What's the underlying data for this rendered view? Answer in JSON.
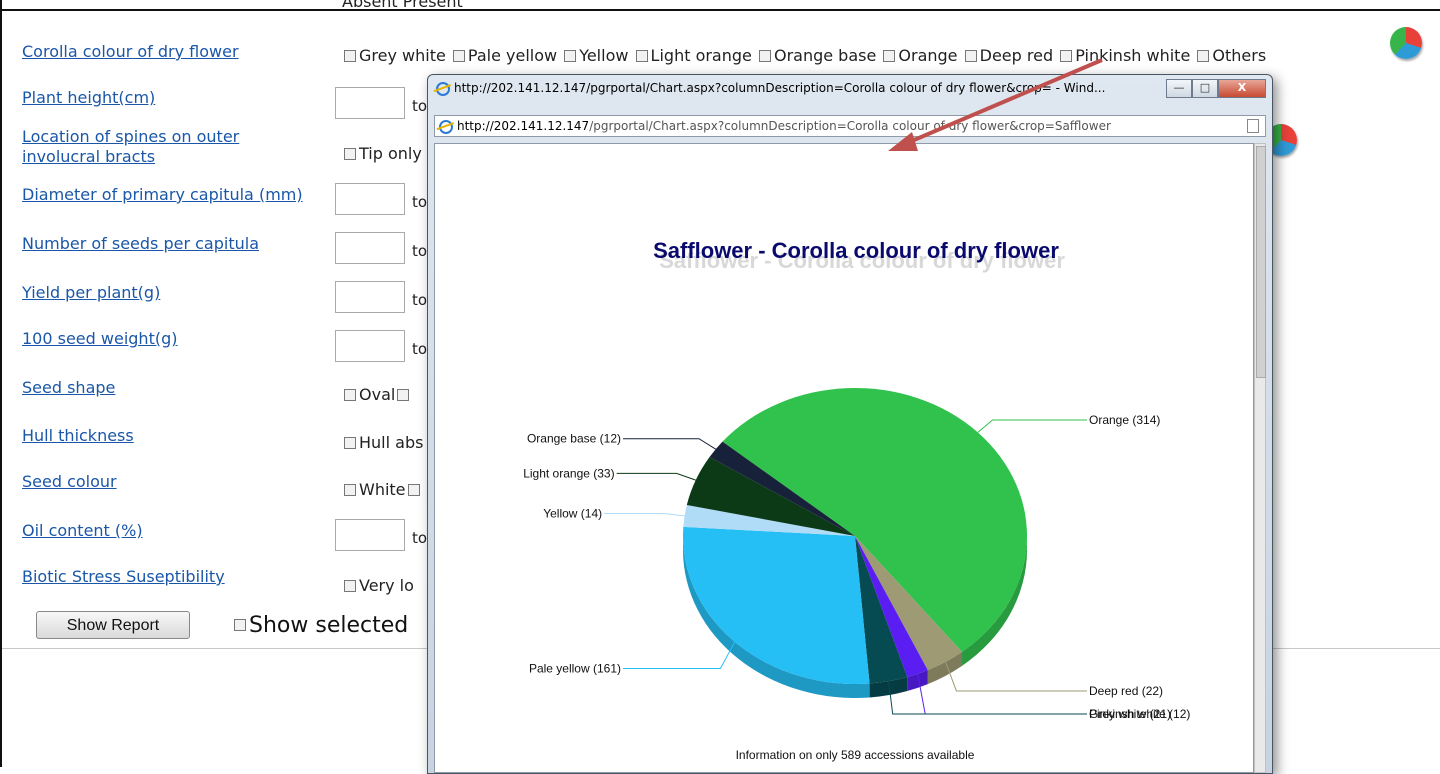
{
  "form": {
    "partial_top": "Absent  Present",
    "rows": [
      {
        "label": "Corolla colour of dry flower"
      },
      {
        "label": "Plant height(cm)"
      },
      {
        "label": "Location of spines on outer involucral bracts"
      },
      {
        "label": "Diameter of primary capitula (mm)"
      },
      {
        "label": "Number of seeds per capitula"
      },
      {
        "label": "Yield per plant(g)"
      },
      {
        "label": "100 seed weight(g)"
      },
      {
        "label": "Seed shape"
      },
      {
        "label": "Hull thickness"
      },
      {
        "label": "Seed colour"
      },
      {
        "label": "Oil content (%)"
      },
      {
        "label": "Biotic Stress Suseptibility"
      }
    ],
    "corolla_options": [
      "Grey white",
      "Pale yellow",
      "Yellow",
      "Light orange",
      "Orange base",
      "Orange",
      "Deep red",
      "Pinkinsh white",
      "Others"
    ],
    "to_label": "to",
    "spines_option": "Tip only",
    "seed_shape_option": "Oval",
    "hull_option": "Hull abs",
    "seed_colour_option": "White",
    "biotic_option": "Very lo",
    "show_report": "Show Report",
    "show_selected": "Show selected"
  },
  "popup": {
    "title": "http://202.141.12.147/pgrportal/Chart.aspx?columnDescription=Corolla colour of dry flower&crop= - Wind...",
    "url_host": "http://202.141.12.147",
    "url_path": "/pgrportal/Chart.aspx?columnDescription=Corolla colour of dry flower&crop=Safflower",
    "footer": "Information on only 589 accessions available"
  },
  "chart_data": {
    "type": "pie",
    "title": "Safflower - Corolla colour of dry flower",
    "slices": [
      {
        "label": "Orange (314)",
        "name": "Orange",
        "value": 314,
        "color": "#31c24d"
      },
      {
        "label": "Deep red (22)",
        "name": "Deep red",
        "value": 22,
        "color": "#9e9a74"
      },
      {
        "label": "Pinkinsh white (12)",
        "name": "Pinkinsh white",
        "value": 12,
        "color": "#5a1ef2"
      },
      {
        "label": "Grey white (21)",
        "name": "Grey white",
        "value": 21,
        "color": "#064a52"
      },
      {
        "label": "Pale yellow (161)",
        "name": "Pale yellow",
        "value": 161,
        "color": "#25bff5"
      },
      {
        "label": "Yellow (14)",
        "name": "Yellow",
        "value": 14,
        "color": "#b1dcf7"
      },
      {
        "label": "Light orange (33)",
        "name": "Light orange",
        "value": 33,
        "color": "#0c3a17"
      },
      {
        "label": "Orange base (12)",
        "name": "Orange base",
        "value": 12,
        "color": "#18213a"
      }
    ]
  }
}
